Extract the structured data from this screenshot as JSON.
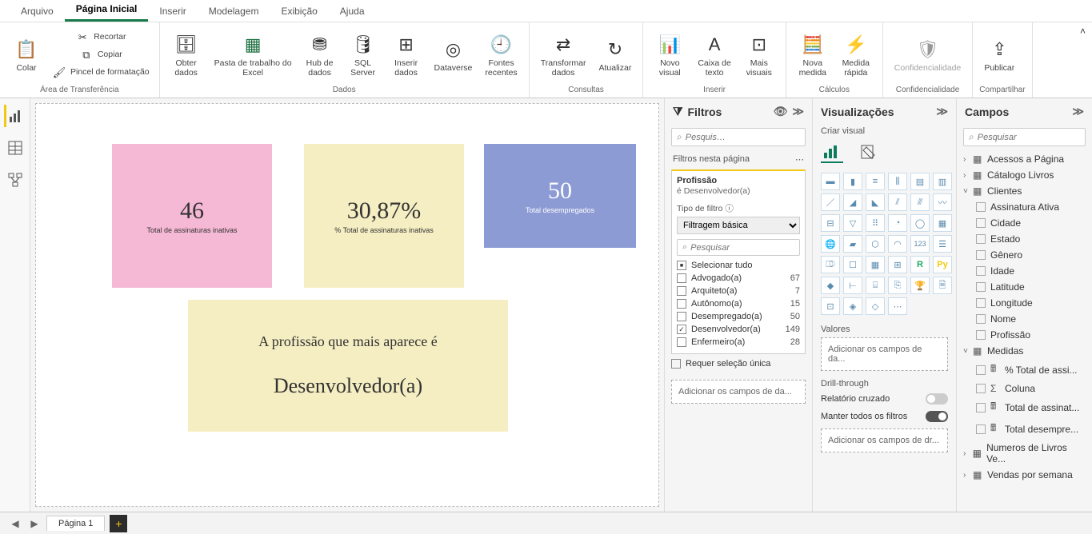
{
  "menu": {
    "tabs": [
      "Arquivo",
      "Página Inicial",
      "Inserir",
      "Modelagem",
      "Exibição",
      "Ajuda"
    ],
    "active": 1
  },
  "ribbon": {
    "clipboard": {
      "paste": "Colar",
      "cut": "Recortar",
      "copy": "Copiar",
      "format": "Pincel de formatação",
      "group": "Área de Transferência"
    },
    "data": {
      "get": "Obter\ndados",
      "excel": "Pasta de trabalho do\nExcel",
      "hub": "Hub de\ndados",
      "sql": "SQL\nServer",
      "insert": "Inserir\ndados",
      "dataverse": "Dataverse",
      "recent": "Fontes\nrecentes",
      "group": "Dados"
    },
    "queries": {
      "transform": "Transformar\ndados",
      "refresh": "Atualizar",
      "group": "Consultas"
    },
    "insert": {
      "visual": "Novo\nvisual",
      "textbox": "Caixa de\ntexto",
      "more": "Mais\nvisuais",
      "group": "Inserir"
    },
    "calc": {
      "measure": "Nova\nmedida",
      "quick": "Medida\nrápida",
      "group": "Cálculos"
    },
    "sens": {
      "label": "Confidencialidade",
      "group": "Confidencialidade"
    },
    "share": {
      "publish": "Publicar",
      "group": "Compartilhar"
    }
  },
  "cards": {
    "c1": {
      "value": "46",
      "label": "Total de assinaturas inativas"
    },
    "c2": {
      "value": "30,87%",
      "label": "% Total de assinaturas inativas"
    },
    "c3": {
      "value": "50",
      "label": "Total desempregados"
    },
    "c4": {
      "title": "A profissão que mais aparece é",
      "answer": "Desenvolvedor(a)"
    }
  },
  "filters": {
    "title": "Filtros",
    "search": "Pesquis…",
    "section": "Filtros nesta página",
    "card": {
      "title": "Profissão",
      "sub": "é Desenvolvedor(a)",
      "typeLabel": "Tipo de filtro",
      "typeValue": "Filtragem básica",
      "search": "Pesquisar",
      "selectAll": "Selecionar tudo",
      "opts": [
        {
          "name": "Advogado(a)",
          "count": 67,
          "checked": false
        },
        {
          "name": "Arquiteto(a)",
          "count": 7,
          "checked": false
        },
        {
          "name": "Autônomo(a)",
          "count": 15,
          "checked": false
        },
        {
          "name": "Desempregado(a)",
          "count": 50,
          "checked": false
        },
        {
          "name": "Desenvolvedor(a)",
          "count": 149,
          "checked": true
        },
        {
          "name": "Enfermeiro(a)",
          "count": 28,
          "checked": false
        }
      ],
      "reqSingle": "Requer seleção única"
    },
    "addFields": "Adicionar os campos de da..."
  },
  "viz": {
    "title": "Visualizações",
    "sub": "Criar visual",
    "values": "Valores",
    "addFields": "Adicionar os campos de da...",
    "drill": "Drill-through",
    "cross": "Relatório cruzado",
    "keep": "Manter todos os filtros",
    "addDrill": "Adicionar os campos de dr..."
  },
  "fields": {
    "title": "Campos",
    "search": "Pesquisar",
    "tables": [
      {
        "name": "Acessos a Página",
        "expanded": false
      },
      {
        "name": "Cátalogo Livros",
        "expanded": false
      },
      {
        "name": "Clientes",
        "expanded": true,
        "children": [
          "Assinatura Ativa",
          "Cidade",
          "Estado",
          "Gênero",
          "Idade",
          "Latitude",
          "Longitude",
          "Nome",
          "Profissão"
        ]
      },
      {
        "name": "Medidas",
        "expanded": true,
        "children": [
          "% Total de assi...",
          "Coluna",
          "Total de assinat...",
          "Total desempre..."
        ],
        "icons": [
          "calc",
          "sigma",
          "calc",
          "calc"
        ]
      },
      {
        "name": "Numeros de Livros Ve...",
        "expanded": false
      },
      {
        "name": "Vendas por semana",
        "expanded": false
      }
    ]
  },
  "page": {
    "name": "Página 1"
  }
}
